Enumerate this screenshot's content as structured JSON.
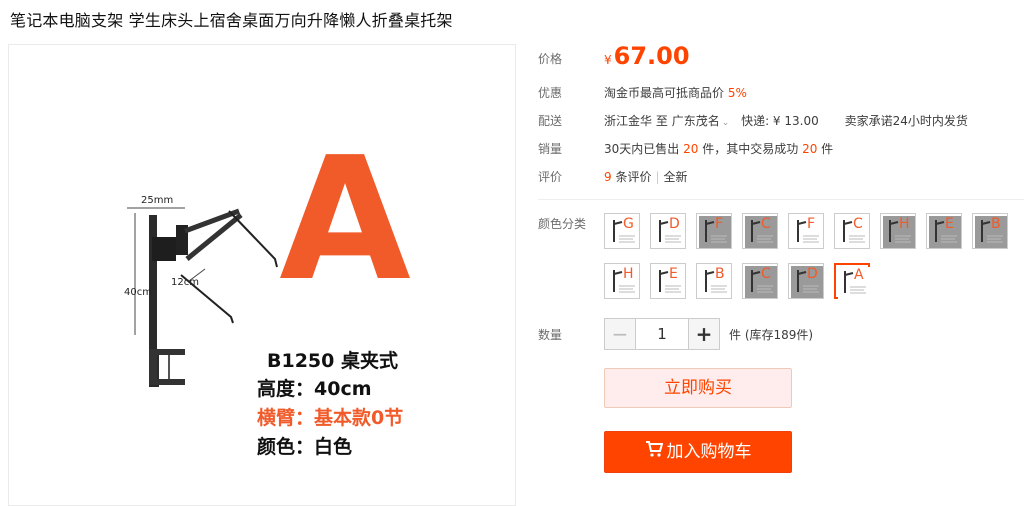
{
  "title": "笔记本电脑支架 学生床头上宿舍桌面万向升降懒人折叠桌托架",
  "product_image": {
    "dim_width": "25mm",
    "dim_height": "40cm",
    "dim_arm": "12cm",
    "big_letter": "A",
    "model": "B1250 桌夹式",
    "spec_height": "高度：40cm",
    "spec_arm": "横臂：基本款0节",
    "spec_color": "颜色：白色"
  },
  "price": {
    "label": "价格",
    "currency": "¥",
    "amount": "67.00"
  },
  "promo": {
    "label": "优惠",
    "text": "淘金币最高可抵商品价",
    "percent": "5%"
  },
  "shipping": {
    "label": "配送",
    "from": "浙江金华",
    "to_word": "至",
    "to": "广东茂名",
    "express": "快递: ¥ 13.00",
    "promise": "卖家承诺24小时内发货"
  },
  "sales": {
    "label": "销量",
    "prefix": "30天内已售出",
    "sold": "20",
    "middle": "件，其中交易成功",
    "success": "20",
    "suffix": "件"
  },
  "reviews": {
    "label": "评价",
    "count": "9",
    "count_suffix": "条评价",
    "all": "全新"
  },
  "colors": {
    "label": "颜色分类",
    "items": [
      "G",
      "D",
      "F",
      "C",
      "F",
      "C",
      "H",
      "E",
      "B",
      "H",
      "E",
      "B",
      "C",
      "D",
      "A"
    ],
    "dark": [
      false,
      false,
      true,
      true,
      false,
      false,
      true,
      true,
      true,
      false,
      false,
      false,
      true,
      true,
      false
    ],
    "selected_index": 14
  },
  "quantity": {
    "label": "数量",
    "minus": "−",
    "value": "1",
    "plus": "+",
    "stock": "件 (库存189件)"
  },
  "buy_now": "立即购买",
  "add_cart": "加入购物车",
  "accent_color": "#ff4400"
}
